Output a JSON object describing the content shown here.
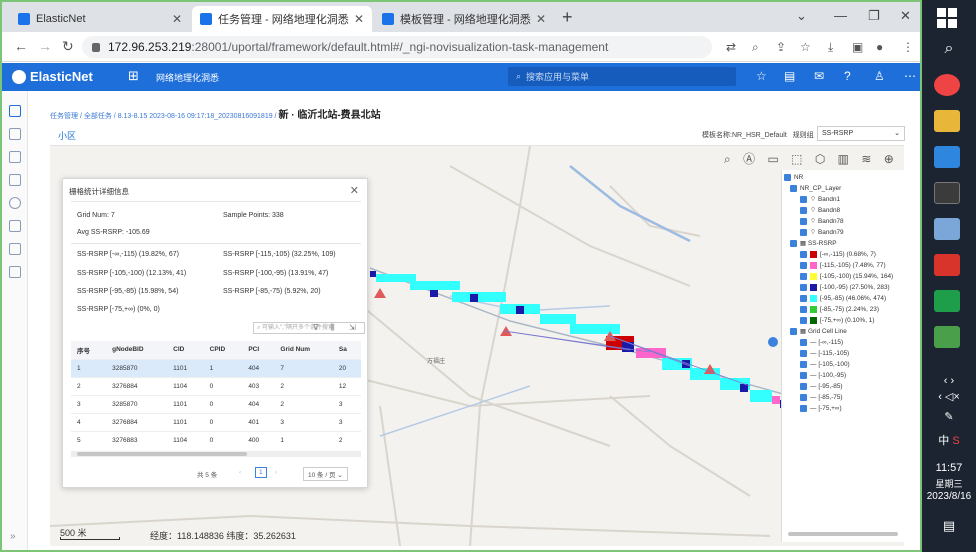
{
  "browser": {
    "tabs": [
      {
        "label": "ElasticNet"
      },
      {
        "label": "任务管理 - 网络地理化洞悉"
      },
      {
        "label": "模板管理 - 网络地理化洞悉"
      }
    ],
    "url_host": "172.96.253.219",
    "url_path": ":28001/uportal/framework/default.html#/_ngi-novisualization-task-management"
  },
  "app": {
    "logo_text": "ElasticNet",
    "app_name": "网络地理化洞悉",
    "search_placeholder": "搜索应用与菜单",
    "accent": "#1e6fd9"
  },
  "breadcrumb": {
    "items": [
      "任务管理",
      "全部任务",
      "8.13-8.15 2023-08-16 09:17:18_20230816091819"
    ],
    "title": "新 · 临沂北站-费县北站"
  },
  "subtab": "小区",
  "toolbar": {
    "template_label": "模板名称:NR_HSR_Default",
    "rule_label": "规则组",
    "rule_value": "SS-RSRP"
  },
  "map": {
    "place_name": "万福庄",
    "scale_label": "500 米",
    "coord_text": "经度：118.148836  纬度：35.262631"
  },
  "popup": {
    "title": "栅格统计详细信息",
    "grid_num": "Grid Num: 7",
    "sample_points": "Sample Points: 338",
    "avg": "Avg SS-RSRP: -105.69",
    "stats": [
      "SS-RSRP [-∞,-115) (19.82%, 67)",
      "SS-RSRP [-115,-105) (32.25%, 109)",
      "SS-RSRP [-105,-100) (12.13%, 41)",
      "SS-RSRP [-100,-95) (13.91%, 47)",
      "SS-RSRP [-95,-85) (15.98%, 54)",
      "SS-RSRP [-85,-75) (5.92%, 20)",
      "SS-RSRP [-75,+∞) (0%, 0)"
    ],
    "filter_placeholder": "可输入\",\"隔开多个条件搜索",
    "columns": [
      "序号",
      "gNodeBID",
      "CID",
      "CPID",
      "PCI",
      "Grid Num",
      "Sa"
    ],
    "rows": [
      [
        "1",
        "3285870",
        "1101",
        "1",
        "404",
        "7",
        "20"
      ],
      [
        "2",
        "3276884",
        "1104",
        "0",
        "403",
        "2",
        "12"
      ],
      [
        "3",
        "3285870",
        "1101",
        "0",
        "404",
        "2",
        "3"
      ],
      [
        "4",
        "3276884",
        "1101",
        "0",
        "401",
        "3",
        "3"
      ],
      [
        "5",
        "3276883",
        "1104",
        "0",
        "400",
        "1",
        "2"
      ]
    ],
    "pager_total": "共 5 条",
    "pager_page": "1",
    "pager_size": "10 条 / 页"
  },
  "layers": {
    "root": "NR",
    "cp_layer": "NR_CP_Layer",
    "bands": [
      "Bandn1",
      "Bandn8",
      "Bandn78",
      "Bandn79"
    ],
    "rsrp_group": "SS-RSRP",
    "rsrp_items": [
      {
        "label": "[-∞,-115) (0.68%, 7)",
        "color": "#cc0000"
      },
      {
        "label": "[-115,-105) (7.48%, 77)",
        "color": "#ff66cc"
      },
      {
        "label": "[-105,-100) (15.94%, 164)",
        "color": "#ffff33"
      },
      {
        "label": "[-100,-95) (27.50%, 283)",
        "color": "#1a1aa8"
      },
      {
        "label": "[-95,-85) (46.06%, 474)",
        "color": "#33ffff"
      },
      {
        "label": "[-85,-75) (2.24%, 23)",
        "color": "#33cc33"
      },
      {
        "label": "[-75,+∞) (0.10%, 1)",
        "color": "#006600"
      }
    ],
    "cell_group": "Grid Cell Line",
    "cell_items": [
      "[-∞,-115)",
      "[-115,-105)",
      "[-105,-100)",
      "[-100,-95)",
      "[-95,-85)",
      "[-85,-75)",
      "[-75,+∞)"
    ]
  },
  "taskbar": {
    "lang": "中",
    "time": "11:57",
    "weekday": "星期三",
    "date": "2023/8/16"
  }
}
